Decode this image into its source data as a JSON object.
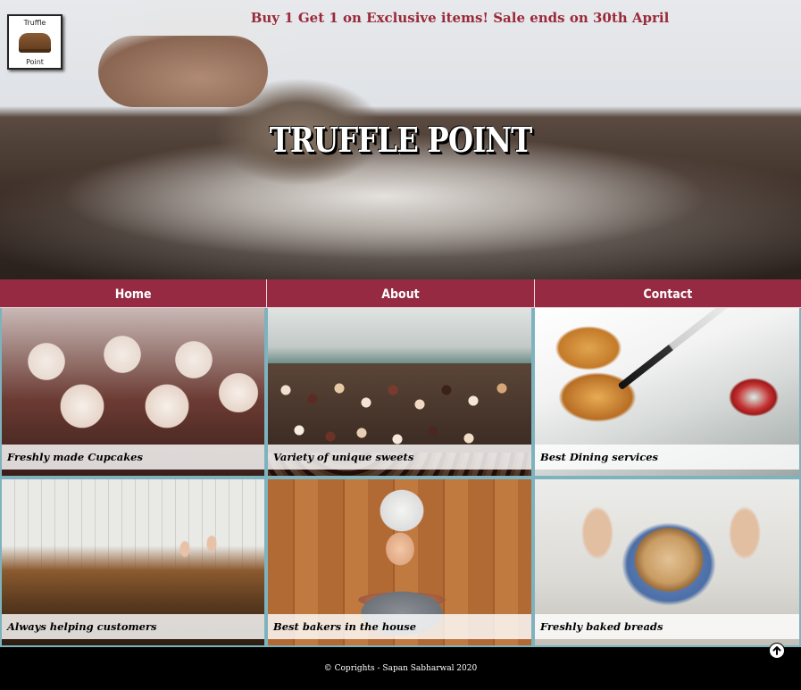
{
  "header": {
    "logo": {
      "line1": "Truffle",
      "line2": "Point"
    },
    "promo": "Buy 1 Get 1 on Exclusive items! Sale ends on 30th April",
    "title": "TRUFFLE POINT"
  },
  "nav": {
    "items": [
      {
        "label": "Home"
      },
      {
        "label": "About"
      },
      {
        "label": "Contact"
      }
    ]
  },
  "gallery": {
    "items": [
      {
        "caption": "Freshly made Cupcakes"
      },
      {
        "caption": "Variety of unique sweets"
      },
      {
        "caption": "Best Dining services"
      },
      {
        "caption": "Always helping customers"
      },
      {
        "caption": "Best bakers in the house"
      },
      {
        "caption": "Freshly baked breads"
      }
    ]
  },
  "footer": {
    "copyright": "© Coprights - Sapan Sabharwal 2020",
    "back_to_top_icon": "arrow-up-circle-icon"
  },
  "colors": {
    "nav_bg": "#952a42",
    "promo_text": "#9a2a3a",
    "tile_border": "#7db3bf",
    "footer_bg": "#000000"
  }
}
